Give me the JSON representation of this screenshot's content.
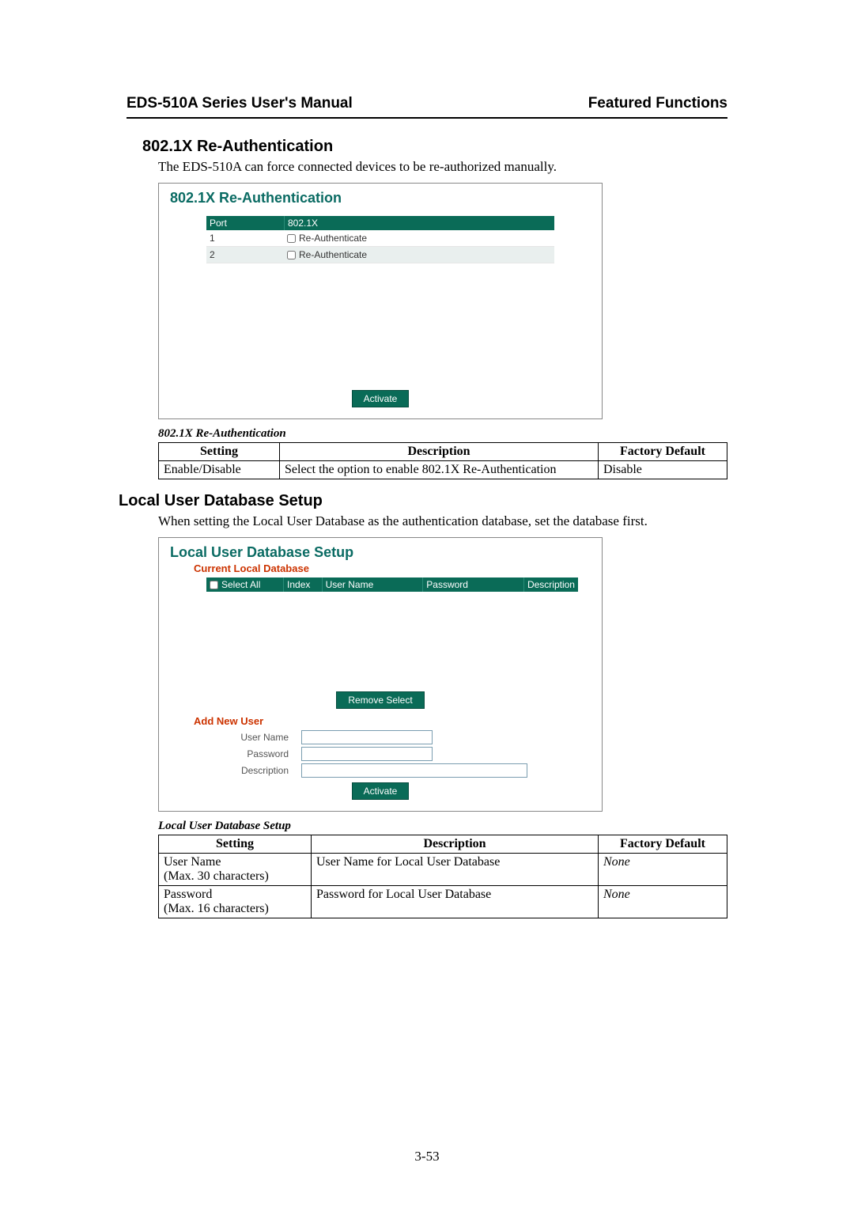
{
  "header": {
    "left": "EDS-510A Series User's Manual",
    "right": "Featured Functions"
  },
  "section1": {
    "heading": "802.1X Re-Authentication",
    "intro": "The EDS-510A can force connected devices to be re-authorized manually."
  },
  "ss1": {
    "title": "802.1X Re-Authentication",
    "cols": {
      "port": "Port",
      "x": "802.1X"
    },
    "rows": [
      {
        "port": "1",
        "label": "Re-Authenticate"
      },
      {
        "port": "2",
        "label": "Re-Authenticate"
      }
    ],
    "activate": "Activate"
  },
  "table1": {
    "caption": "802.1X Re-Authentication",
    "headers": {
      "setting": "Setting",
      "desc": "Description",
      "def": "Factory Default"
    },
    "rows": [
      {
        "setting": "Enable/Disable",
        "desc": "Select the option to enable 802.1X Re-Authentication",
        "def": "Disable"
      }
    ]
  },
  "section2": {
    "heading": "Local User Database Setup",
    "intro": "When setting the Local User Database as the authentication database, set the database first."
  },
  "ss2": {
    "title": "Local User Database Setup",
    "subtitle": "Current Local Database",
    "cols": {
      "select_all": "Select All",
      "index": "Index",
      "user": "User Name",
      "pass": "Password",
      "desc": "Description"
    },
    "remove": "Remove Select",
    "add_new": "Add New User",
    "form": {
      "user": "User Name",
      "pass": "Password",
      "desc": "Description"
    },
    "activate": "Activate"
  },
  "table2": {
    "caption": "Local User Database Setup",
    "headers": {
      "setting": "Setting",
      "desc": "Description",
      "def": "Factory Default"
    },
    "rows": [
      {
        "setting_l1": "User Name",
        "setting_l2": "(Max. 30 characters)",
        "desc": "User Name for Local User Database",
        "def": "None"
      },
      {
        "setting_l1": "Password",
        "setting_l2": "(Max. 16 characters)",
        "desc": "Password for Local User Database",
        "def": "None"
      }
    ]
  },
  "page_number": "3-53"
}
